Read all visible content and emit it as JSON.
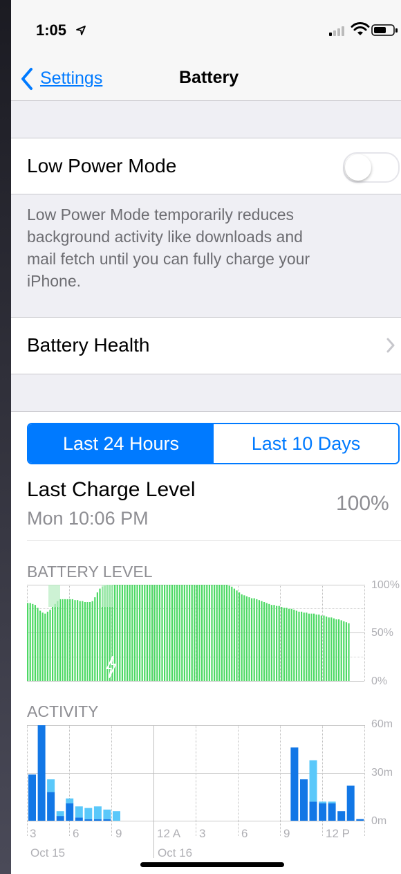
{
  "status_bar": {
    "time": "1:05"
  },
  "nav": {
    "back_label": "Settings",
    "title": "Battery"
  },
  "low_power": {
    "label": "Low Power Mode",
    "enabled": false,
    "description": [
      "Low Power Mode temporarily reduces",
      "background activity like downloads and",
      "mail fetch until you can fully charge your",
      "iPhone."
    ]
  },
  "battery_health": {
    "label": "Battery Health"
  },
  "segments": {
    "active": "Last 24 Hours",
    "inactive": "Last 10 Days"
  },
  "last_charge": {
    "label": "Last Charge Level",
    "time": "Mon 10:06 PM",
    "value": "100%"
  },
  "colors": {
    "accent": "#007aff",
    "battery_green": "#4cd964",
    "activity_dark": "#1277e6",
    "activity_light": "#5ac8fa"
  },
  "chart_data": [
    {
      "type": "bar",
      "title": "BATTERY LEVEL",
      "y_tick_labels": [
        "100%",
        "50%",
        "0%"
      ],
      "ylim": [
        0,
        100
      ],
      "values": [
        81,
        81,
        80,
        79,
        76,
        73,
        71,
        70,
        72,
        74,
        77,
        80,
        83,
        85,
        85,
        85,
        85,
        85,
        85,
        84,
        84,
        83,
        83,
        82,
        82,
        82,
        83,
        87,
        92,
        96,
        98,
        99,
        100,
        100,
        100,
        100,
        100,
        100,
        100,
        100,
        100,
        100,
        100,
        100,
        100,
        100,
        100,
        100,
        100,
        100,
        100,
        100,
        100,
        100,
        100,
        100,
        100,
        100,
        100,
        100,
        100,
        100,
        100,
        100,
        100,
        100,
        100,
        100,
        100,
        100,
        100,
        100,
        100,
        100,
        100,
        100,
        100,
        100,
        100,
        100,
        100,
        99,
        98,
        96,
        94,
        92,
        90,
        89,
        88,
        87,
        86,
        86,
        85,
        84,
        83,
        82,
        81,
        80,
        79,
        79,
        78,
        78,
        77,
        76,
        76,
        75,
        75,
        74,
        73,
        72,
        72,
        71,
        71,
        70,
        70,
        70,
        69,
        69,
        68,
        68,
        67,
        66,
        66,
        65,
        64,
        64,
        63,
        62,
        61,
        60
      ]
    },
    {
      "type": "bar",
      "title": "ACTIVITY",
      "y_tick_labels": [
        "60m",
        "30m",
        "0m"
      ],
      "ylim": [
        0,
        60
      ],
      "x_tick_labels": [
        "3",
        "6",
        "9",
        "12 A",
        "3",
        "6",
        "9",
        "12 P"
      ],
      "date_labels": [
        "Oct 15",
        "Oct 16"
      ],
      "series": [
        {
          "name": "screen_on",
          "values": [
            29,
            61,
            18,
            3,
            11,
            2,
            1,
            1,
            1,
            0,
            0,
            0,
            0,
            0,
            0,
            0,
            0,
            0,
            0,
            0,
            0,
            0,
            0,
            0,
            0,
            0,
            0,
            0,
            46,
            26,
            12,
            11,
            11,
            6,
            22,
            1
          ]
        },
        {
          "name": "screen_off",
          "values": [
            0,
            0,
            8,
            3,
            3,
            7,
            7,
            8,
            6,
            6,
            0,
            0,
            0,
            0,
            0,
            0,
            0,
            0,
            0,
            0,
            0,
            0,
            0,
            0,
            0,
            0,
            0,
            0,
            0,
            0,
            26,
            1,
            1,
            0,
            0,
            0
          ]
        }
      ]
    }
  ]
}
